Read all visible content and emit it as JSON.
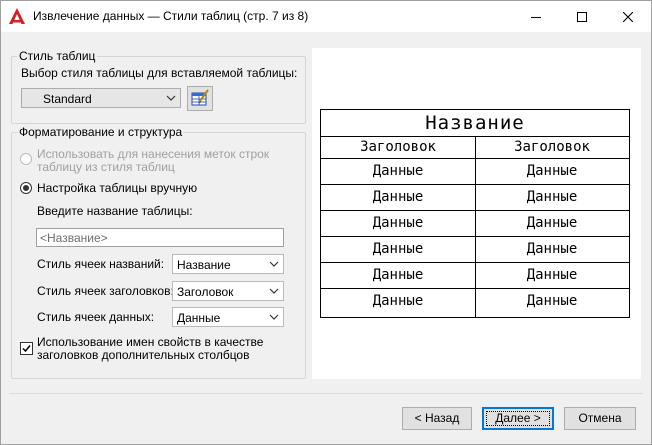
{
  "window": {
    "title": "Извлечение данных — Стили таблиц (стр. 7 из 8)"
  },
  "table_style": {
    "legend": "Стиль таблиц",
    "select_label": "Выбор стиля таблицы для вставляемой таблицы:",
    "style_value": "Standard"
  },
  "formatting": {
    "legend": "Форматирование и структура",
    "radio_use_labels_line1": "Использовать для нанесения меток строк",
    "radio_use_labels_line2": "таблицу из стиля таблиц",
    "radio_manual": "Настройка таблицы вручную",
    "table_name_label": "Введите название таблицы:",
    "table_name_placeholder": "<Название>",
    "title_cell_label": "Стиль ячеек названий:",
    "title_cell_value": "Название",
    "header_cell_label": "Стиль ячеек заголовков:",
    "header_cell_value": "Заголовок",
    "data_cell_label": "Стиль ячеек данных:",
    "data_cell_value": "Данные",
    "checkbox_line1": "Использование имен свойств в качестве",
    "checkbox_line2": "заголовков дополнительных столбцов"
  },
  "preview": {
    "title": "Название",
    "headers": [
      "Заголовок",
      "Заголовок"
    ],
    "rows": [
      [
        "Данные",
        "Данные"
      ],
      [
        "Данные",
        "Данные"
      ],
      [
        "Данные",
        "Данные"
      ],
      [
        "Данные",
        "Данные"
      ],
      [
        "Данные",
        "Данные"
      ],
      [
        "Данные",
        "Данные"
      ]
    ]
  },
  "buttons": {
    "back": "< Назад",
    "next": "Далее >",
    "cancel": "Отмена"
  },
  "colors": {
    "accent": "#0078d7",
    "app_icon": "#d51f27"
  }
}
